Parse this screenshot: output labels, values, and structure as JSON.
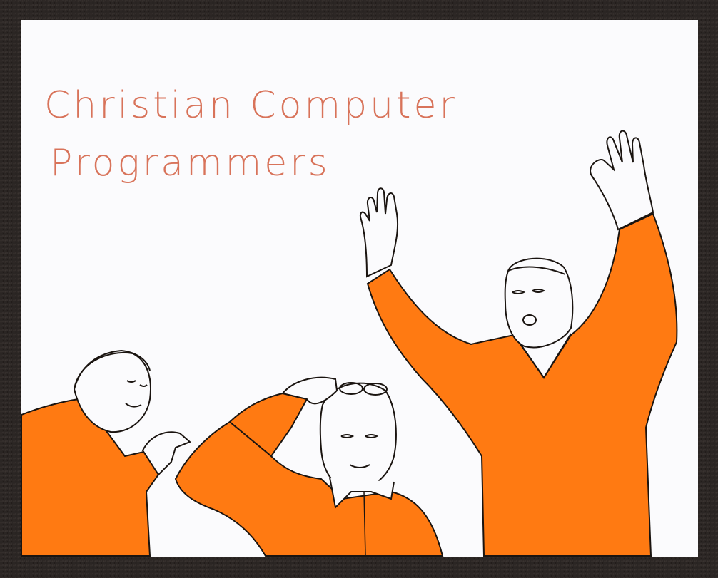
{
  "caption": {
    "line1": "Christian Computer",
    "line2": "Programmers"
  },
  "colors": {
    "frame": "#2b2624",
    "paper": "#fbfbfd",
    "shirt": "#ff7a12",
    "ink": "#1a1410",
    "caption_ink": "#d8735a"
  },
  "figures": [
    {
      "id": "left",
      "pose": "singing, one hand raised in front of chest"
    },
    {
      "id": "middle",
      "pose": "hand on head, glasses pushed up, smiling"
    },
    {
      "id": "right",
      "pose": "both arms raised, mouth open"
    }
  ]
}
